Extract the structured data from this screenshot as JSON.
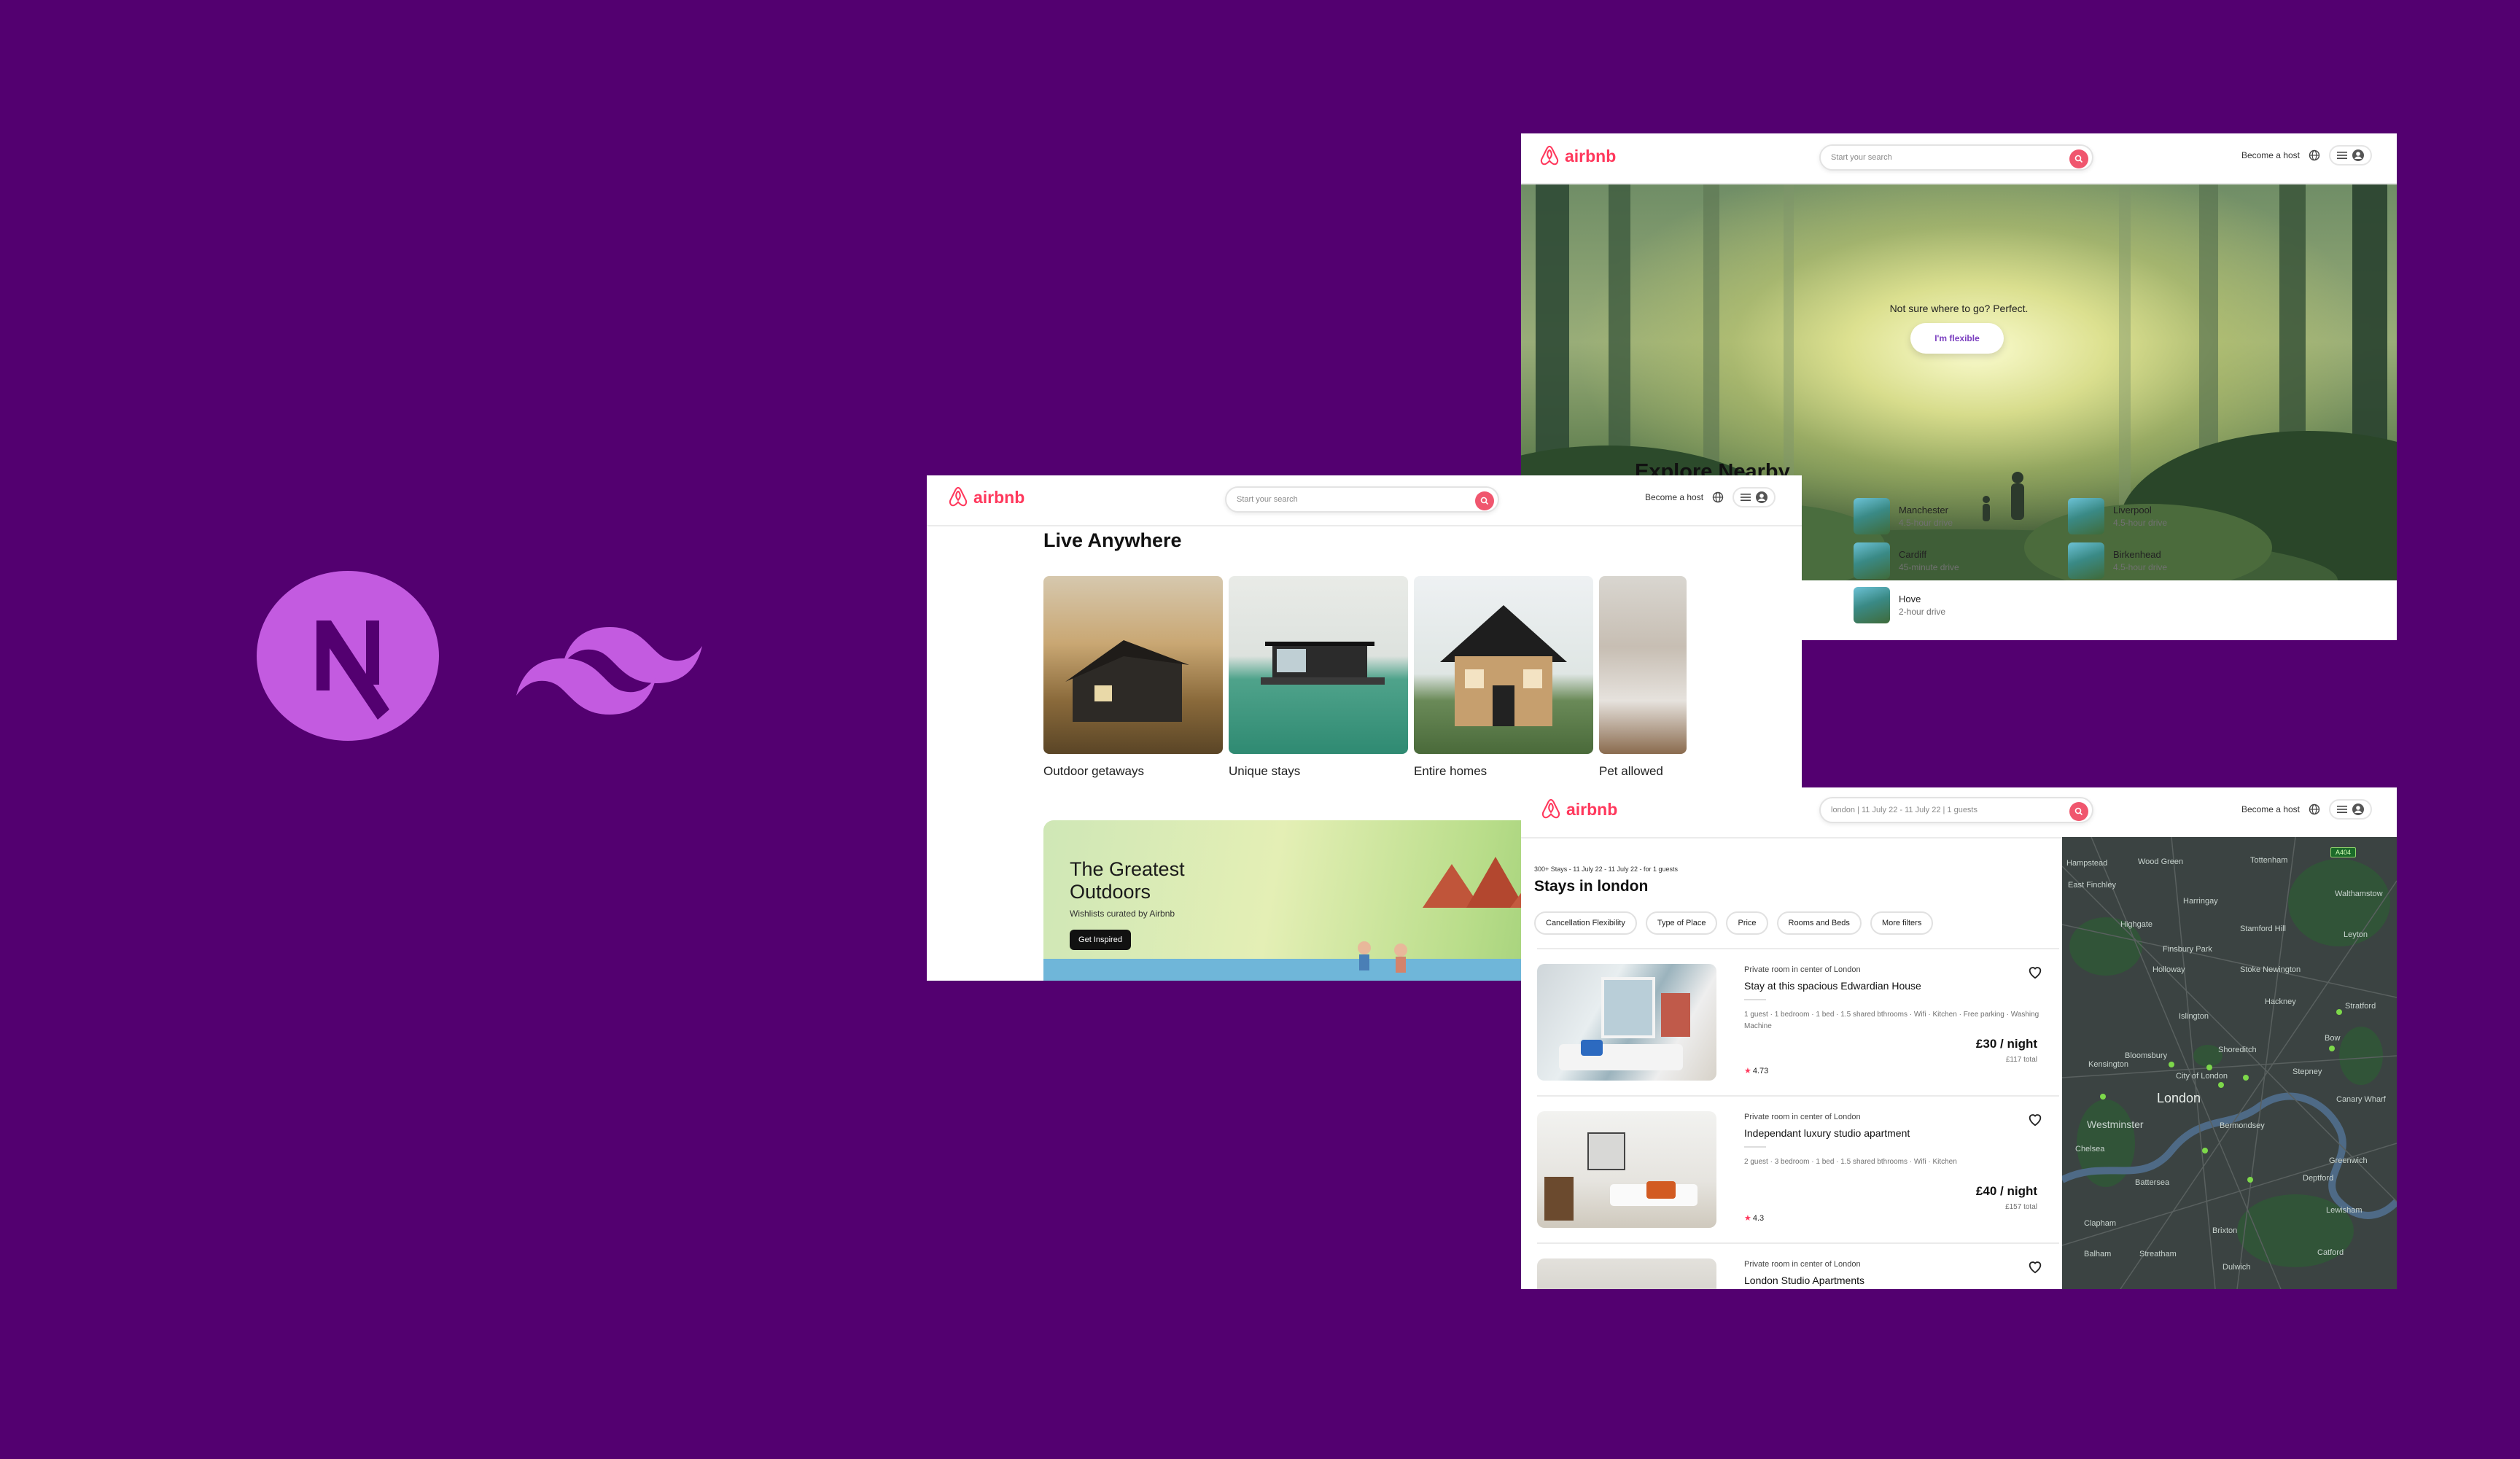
{
  "colors": {
    "background": "#530070",
    "brand": "#FF385C",
    "logo_accent": "#C35BE0"
  },
  "icons": {
    "next": "nextjs-logo-icon",
    "tailwind": "tailwind-logo-icon",
    "globe": "globe-icon",
    "menu": "hamburger-menu-icon",
    "user": "user-avatar-icon",
    "search": "search-icon",
    "heart": "heart-icon",
    "star": "star-icon"
  },
  "brand_name": "airbnb",
  "header": {
    "search_placeholder": "Start your search",
    "become_host": "Become a host"
  },
  "window1": {
    "hero_question": "Not sure where to go? Perfect.",
    "flexible_button": "I'm flexible",
    "nearby_title": "Explore Nearby",
    "nearby": [
      {
        "name": "Manchester",
        "drive": "4.5-hour drive"
      },
      {
        "name": "Liverpool",
        "drive": "4.5-hour drive"
      },
      {
        "name": "Cardiff",
        "drive": "45-minute drive"
      },
      {
        "name": "Birkenhead",
        "drive": "4.5-hour drive"
      },
      {
        "name": "Hove",
        "drive": "2-hour drive"
      }
    ]
  },
  "window2": {
    "title": "Live Anywhere",
    "categories": [
      "Outdoor getaways",
      "Unique stays",
      "Entire homes",
      "Pet allowed"
    ],
    "promo": {
      "title_line1": "The Greatest",
      "title_line2": "Outdoors",
      "subtitle": "Wishlists curated by Airbnb",
      "button": "Get Inspired"
    }
  },
  "window3": {
    "search_value": "london | 11 July 22 - 11 July 22 | 1 guests",
    "stays_meta": "300+ Stays - 11 July 22 - 11 July 22 - for 1 guests",
    "stays_title": "Stays in london",
    "filters": [
      "Cancellation Flexibility",
      "Type of Place",
      "Price",
      "Rooms and Beds",
      "More filters"
    ],
    "listings": [
      {
        "type": "Private room in center of London",
        "title": "Stay at this spacious Edwardian House",
        "amenities": "1 guest · 1 bedroom · 1 bed · 1.5 shared bthrooms · Wifi · Kitchen · Free parking · Washing Machine",
        "rating": "4.73",
        "price": "£30 / night",
        "total": "£117 total"
      },
      {
        "type": "Private room in center of London",
        "title": "Independant luxury studio apartment",
        "amenities": "2 guest · 3 bedroom · 1 bed · 1.5 shared bthrooms · Wifi · Kitchen",
        "rating": "4.3",
        "price": "£40 / night",
        "total": "£157 total"
      },
      {
        "type": "Private room in center of London",
        "title": "London Studio Apartments"
      }
    ],
    "map": {
      "badge": "A404",
      "labels": [
        "London",
        "City of London",
        "Westminster",
        "Islington",
        "Hackney",
        "Stratford",
        "Greenwich",
        "Lewisham",
        "Brixton",
        "Chelsea",
        "Bow",
        "Leyton",
        "Hampstead",
        "Tottenham",
        "Walthamstow",
        "Highgate",
        "Stepney",
        "Canary Wharf",
        "Bermondsey",
        "Deptford",
        "Wood Green",
        "Harringay",
        "Holloway",
        "Finsbury Park",
        "Stamford Hill",
        "Stoke Newington",
        "Shoreditch",
        "Battersea",
        "Clapham",
        "Balham",
        "Streatham",
        "Dulwich",
        "Catford",
        "Kensington",
        "East Finchley",
        "Bloomsbury"
      ]
    }
  }
}
